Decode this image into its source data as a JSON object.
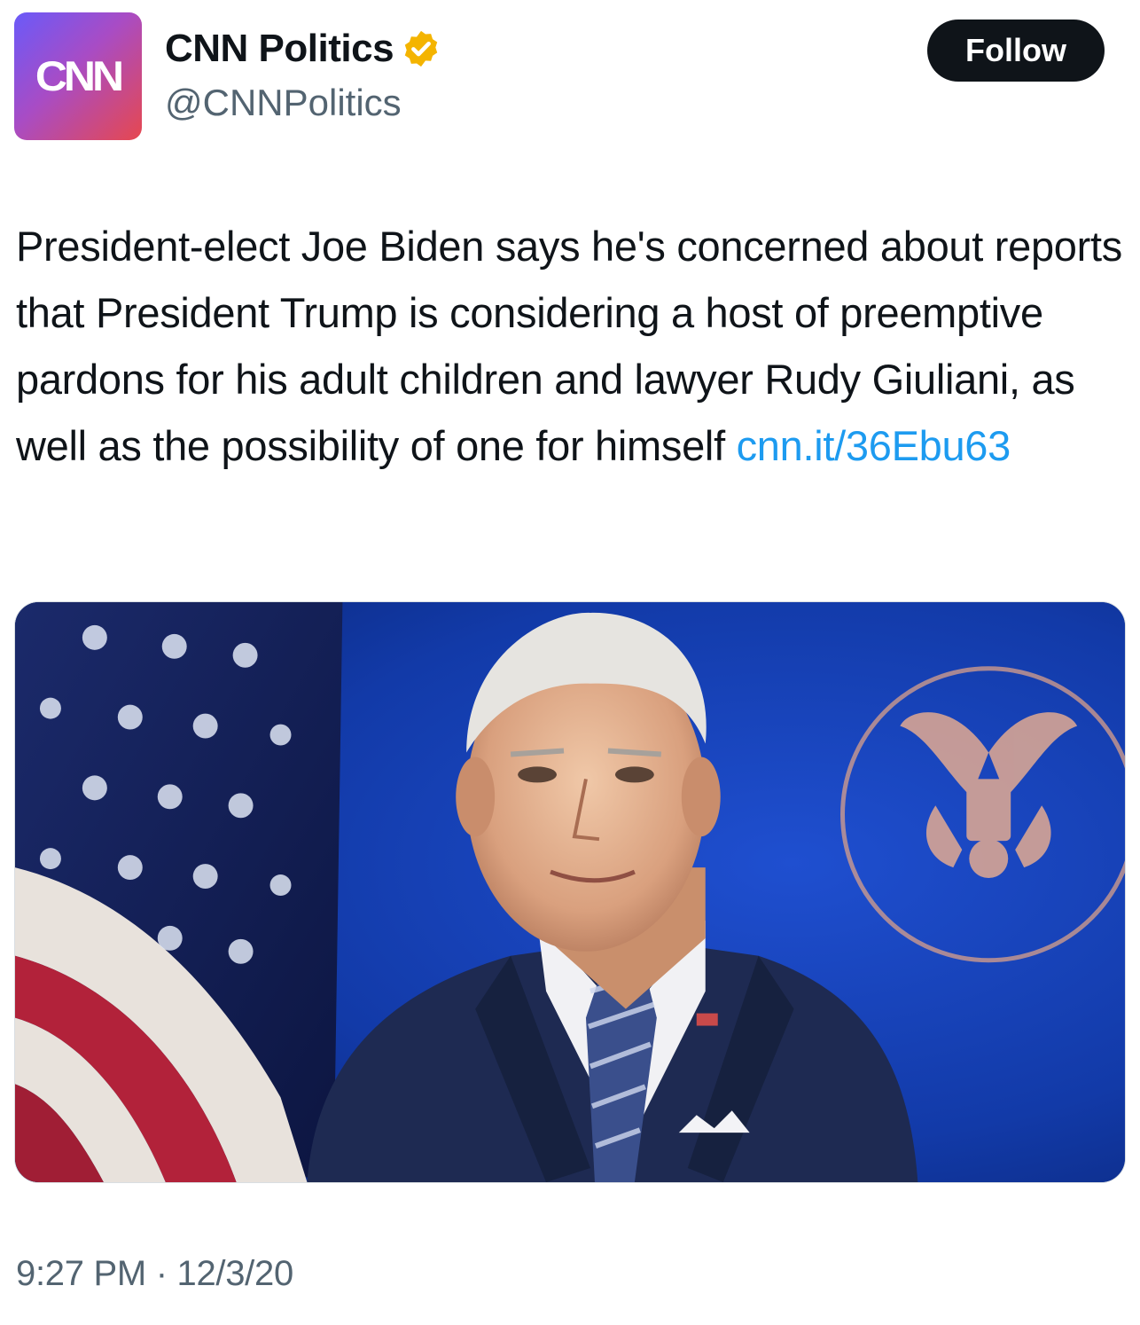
{
  "account": {
    "avatar_logo": "CNN",
    "display_name": "CNN Politics",
    "handle": "@CNNPolitics",
    "verified_badge_color": "#f4b400"
  },
  "follow_button": {
    "label": "Follow"
  },
  "tweet": {
    "text": "President-elect Joe Biden says he's concerned about reports that President Trump is considering a host of preemptive pardons for his adult children and lawyer Rudy Giuliani, as well as the possibility of one for himself ",
    "link_text": "cnn.it/36Ebu63",
    "link_color": "#1d9bf0"
  },
  "media": {
    "icon": "photo"
  },
  "meta": {
    "time": "9:27 PM",
    "separator": " · ",
    "date": "12/3/20"
  },
  "colors": {
    "text": "#0f1419",
    "secondary_text": "#536471",
    "button_bg": "#0f1419",
    "button_text": "#ffffff",
    "avatar_gradient": [
      "#6a5af9",
      "#a84cc5",
      "#e6484f"
    ]
  }
}
